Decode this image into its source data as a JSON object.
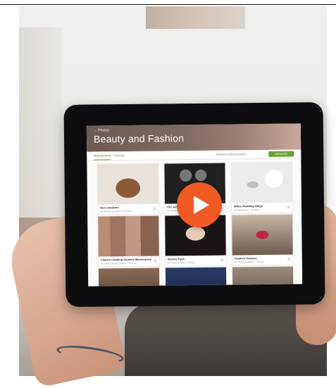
{
  "colors": {
    "accent_green": "#6aa333",
    "play_orange": "#f15a24"
  },
  "app": {
    "breadcrumb": "← Photos",
    "title": "Beauty and Fashion",
    "tabs": [
      {
        "label": "Wonderland",
        "active": true
      },
      {
        "label": "Popular",
        "active": false
      }
    ],
    "sort_label": "Newest subscriptions",
    "cta_label": "Subscribe"
  },
  "cards": [
    {
      "title": "New sneakers",
      "meta": "by Wandering Moon • Photos",
      "icon": "shoes-photo"
    },
    {
      "title": "Old school Goggles",
      "meta": "by Skybox • Photos",
      "icon": "goggles-photo"
    },
    {
      "title": "White Wedding Rings",
      "meta": "by Kathyanne • Photos",
      "icon": "rings-photo"
    },
    {
      "title": "Classic Clothing Screens Mannequins",
      "meta": "by Flash Design Sherry • Photos",
      "icon": "mannequin-photo"
    },
    {
      "title": "Intense Eyes",
      "meta": "by JustPlymolet • Photos",
      "icon": "woman-photo"
    },
    {
      "title": "Fashion Glasses",
      "meta": "by Planet Spirited • Photos",
      "icon": "glasses-photo"
    },
    {
      "title": "",
      "meta": "",
      "icon": "photo"
    },
    {
      "title": "",
      "meta": "",
      "icon": "photo"
    },
    {
      "title": "",
      "meta": "",
      "icon": "photo"
    }
  ],
  "video": {
    "play_icon": "play-icon"
  }
}
